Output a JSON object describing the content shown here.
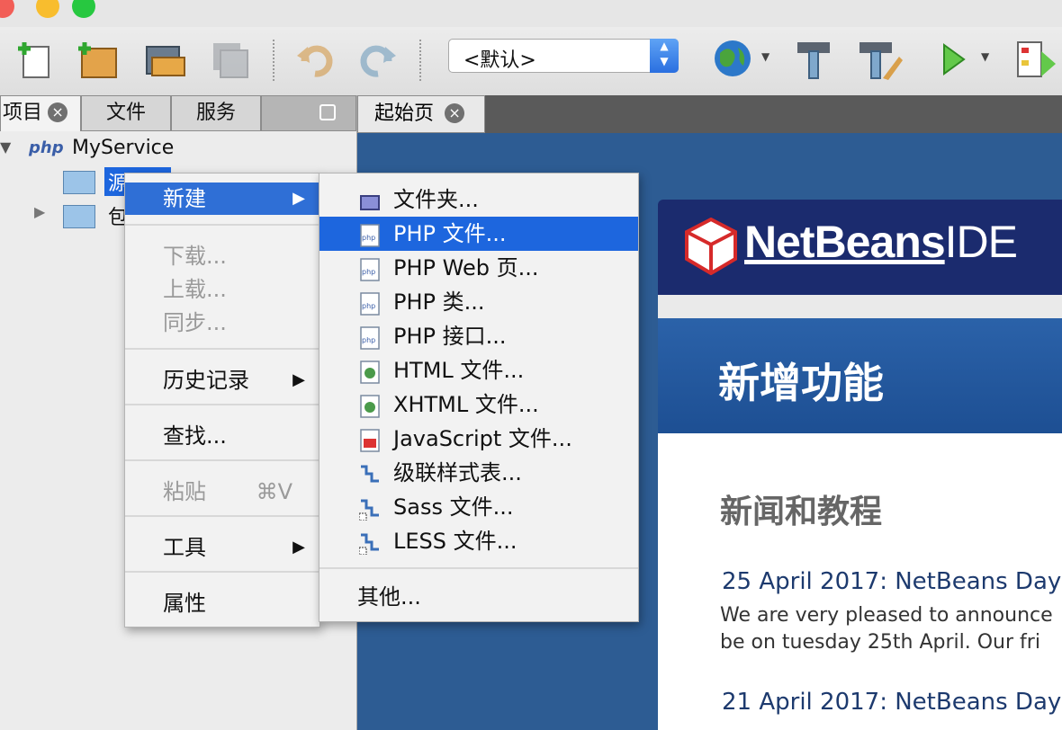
{
  "toolbar": {
    "configuration": "<默认>",
    "icons": [
      "new-file-icon",
      "new-project-icon",
      "open-project-icon",
      "save-all-icon",
      "undo-icon",
      "redo-icon",
      "globe-icon",
      "build-hammer-icon",
      "clean-build-icon",
      "run-icon",
      "debug-icon"
    ]
  },
  "left_panel": {
    "tabs": [
      {
        "label": "项目",
        "active": true
      },
      {
        "label": "文件",
        "active": false
      },
      {
        "label": "服务",
        "active": false
      }
    ],
    "project_name": "MyService",
    "tree_items": [
      "源文件",
      "包含路径"
    ]
  },
  "editor": {
    "tab_label": "起始页",
    "logo_text": "NetBeans",
    "logo_suffix": "IDE",
    "section_title": "新增功能",
    "news_title": "新闻和教程",
    "news": [
      {
        "headline": "25 April 2017: NetBeans Day",
        "body": [
          "We are very pleased to announce",
          "be on tuesday 25th April. Our fri"
        ]
      },
      {
        "headline": "21 April 2017: NetBeans Day"
      }
    ]
  },
  "context_menu": {
    "items": [
      {
        "label": "新建",
        "submenu": true,
        "selected": true
      },
      {
        "label": "下载...",
        "disabled": true
      },
      {
        "label": "上载...",
        "disabled": true
      },
      {
        "label": "同步...",
        "disabled": true
      },
      {
        "label": "历史记录",
        "submenu": true
      },
      {
        "label": "查找..."
      },
      {
        "label": "粘贴",
        "shortcut": "⌘V",
        "disabled": true
      },
      {
        "label": "工具",
        "submenu": true
      },
      {
        "label": "属性"
      }
    ]
  },
  "submenu": {
    "items": [
      {
        "label": "文件夹...",
        "icon": "folder-icon"
      },
      {
        "label": "PHP 文件...",
        "icon": "php-file-icon",
        "selected": true
      },
      {
        "label": "PHP Web 页...",
        "icon": "php-file-icon"
      },
      {
        "label": "PHP 类...",
        "icon": "php-file-icon"
      },
      {
        "label": "PHP 接口...",
        "icon": "php-file-icon"
      },
      {
        "label": "HTML 文件...",
        "icon": "html-file-icon"
      },
      {
        "label": "XHTML 文件...",
        "icon": "html-file-icon"
      },
      {
        "label": "JavaScript 文件...",
        "icon": "js-file-icon"
      },
      {
        "label": "级联样式表...",
        "icon": "css-file-icon"
      },
      {
        "label": "Sass 文件...",
        "icon": "sass-file-icon"
      },
      {
        "label": "LESS 文件...",
        "icon": "less-file-icon"
      },
      {
        "label": "其他..."
      }
    ]
  },
  "colors": {
    "selection": "#1d66de",
    "netbeans_banner": "#1b2b6e",
    "start_page_blue": "#2b62a9"
  }
}
